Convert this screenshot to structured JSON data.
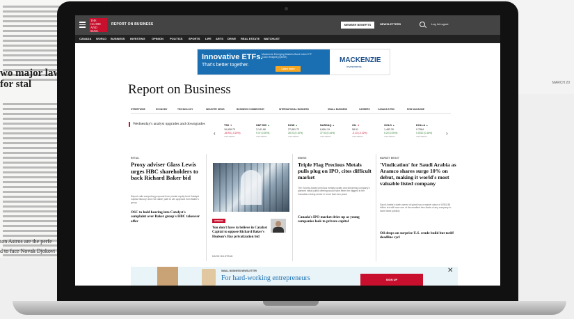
{
  "background": {
    "headline": "wo major law fi pay cuts for stal",
    "footer_line1": "ton Astros are the perfe",
    "footer_line2": "d to face Novak Djokovi",
    "date": "MARCH 20"
  },
  "header": {
    "logo_text": "THE GLOBE AND MAIL",
    "section_name": "REPORT ON BUSINESS",
    "member_button": "MEMBER BENEFITS",
    "newsletters": "NEWSLETTERS",
    "login": "Log In/Logout"
  },
  "nav": [
    "CANADA",
    "WORLD",
    "BUSINESS",
    "INVESTING",
    "OPINION",
    "POLITICS",
    "SPORTS",
    "LIFE",
    "ARTS",
    "DRIVE",
    "REAL ESTATE",
    "WATCHLIST"
  ],
  "ad": {
    "title": "Innovative ETFs.",
    "subtitle": "That's better together.",
    "fine_print": "Mackenzie Emerging Markets Bond Index ETF (CAD-Hedged) (QEBH)",
    "cta": "Learn more",
    "brand": "MACKENZIE",
    "brand_sub": "Investments"
  },
  "page_title": "Report on Business",
  "subnav": [
    "STREETWISE",
    "ECONOMY",
    "TECHNOLOGY",
    "INDUSTRY NEWS",
    "BUSINESS COMMENTARY",
    "INTERNATIONAL BUSINESS",
    "SMALL BUSINESS",
    "CAREERS",
    "CANADA'S FBX",
    "ROB MAGAZINE"
  ],
  "markets": {
    "upgrade_text": "Wednesday's analyst upgrades and downgrades",
    "tickers": [
      {
        "name": "TSX",
        "dir": "down",
        "value": "16,658.70",
        "change": "-38.93 (-0.23%)",
        "pct": "4:00 PM ET"
      },
      {
        "name": "S&P 500",
        "dir": "up",
        "value": "3,141.86",
        "change": "9.47 (0.30%)",
        "pct": "4:00 PM ET"
      },
      {
        "name": "DOW",
        "dir": "up",
        "value": "27,881.72",
        "change": "28.01 (0.10%)",
        "pct": "4:00 PM ET"
      },
      {
        "name": "NASDAQ",
        "dir": "up",
        "value": "8,654.19",
        "change": "37.92 (0.44%)",
        "pct": "4:00 PM ET"
      },
      {
        "name": "OIL",
        "dir": "down",
        "value": "58.91",
        "change": "-0.13 (-0.22%)",
        "pct": "4:00 PM ET"
      },
      {
        "name": "GOLD",
        "dir": "up",
        "value": "1,482.30",
        "change": "5.20 (0.35%)",
        "pct": "4:00 PM ET"
      },
      {
        "name": "DOLLA",
        "dir": "up",
        "value": "0.7584",
        "change": "0.0012 (0.16%)",
        "pct": "4:00 PM ET"
      }
    ]
  },
  "stories": {
    "retail": {
      "label": "RETAIL",
      "headline": "Proxy adviser Glass Lewis urges HBC shareholders to back Richard Baker bid",
      "body": "Report calls competing proposal from private equity fund Catalyst Capital 'illusory' and 'not viable' path to win approval from Baker's group",
      "teaser": "OSC to hold hearing into Catalyst's complaint over Baker group's HBC takeover offer"
    },
    "opinion": {
      "badge": "OPINION",
      "headline": "You don't have to believe in Catalyst Capital to oppose Richard Baker's Hudson's Bay privatization bid",
      "author": "DAVID MILSTEAD"
    },
    "mining": {
      "label": "MINING",
      "headline": "Triple Flag Precious Metals pulls plug on IPO, cites difficult market",
      "body": "The Toronto-based precious metals royalty and streaming company's planned initial public offering would have been the biggest in the Canadian mining sector in more than two years",
      "teaser": "Canada's IPO market dries up as young companies look to private capital"
    },
    "market": {
      "label": "MARKET BEGUT",
      "headline": "'Vindication' for Saudi Arabia as Aramco shares surge 10% on debut, making it world's most valuable listed company",
      "body": "Saudi Arabia's state-owned oil giant has a market value of US$1.88 trillion but will have one of the smallest free floats of any company to have listed publicly",
      "teaser": "Oil drops on surprise U.S. crude build but tariff deadline cycl"
    }
  },
  "newsletter": {
    "label": "SMALL BUSINESS NEWSLETTER",
    "title": "For hard-working entrepreneurs",
    "button": "SIGN UP",
    "close": "✕"
  }
}
